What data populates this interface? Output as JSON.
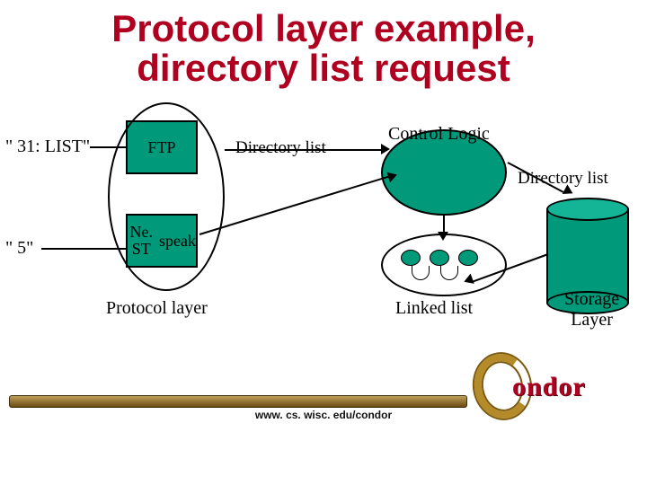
{
  "title_line1": "Protocol layer example,",
  "title_line2": "directory list request",
  "labels": {
    "list_cmd": "\" 31: LIST\"",
    "five": "\" 5\"",
    "ftp": "FTP",
    "nest_speak_l1": "Ne. ST",
    "nest_speak_l2": "speak",
    "dir_list_1": "Directory list",
    "control_logic": "Control Logic",
    "dir_list_2": "Directory list",
    "protocol_layer": "Protocol layer",
    "linked_list": "Linked list",
    "storage_layer_l1": "Storage",
    "storage_layer_l2": "Layer"
  },
  "footer_url": "www. cs. wisc. edu/condor",
  "logo_text": "ondor",
  "colors": {
    "title": "#b00020",
    "shape_fill": "#009a7a"
  }
}
